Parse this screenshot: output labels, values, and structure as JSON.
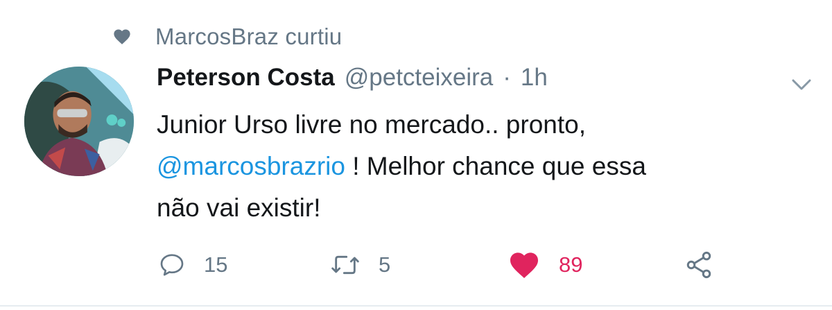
{
  "social_context": {
    "text": "MarcosBraz curtiu",
    "icon": "heart-icon"
  },
  "author": {
    "name": "Peterson Costa",
    "handle": "@petcteixeira",
    "separator": "·",
    "time": "1h"
  },
  "tweet": {
    "line1": "Junior Urso livre no mercado.. pronto,",
    "mention": "@marcosbrazrio",
    "line2_rest": " ! Melhor chance que essa",
    "line3": "não vai existir!"
  },
  "actions": {
    "reply": {
      "icon": "reply-icon",
      "count": "15"
    },
    "retweet": {
      "icon": "retweet-icon",
      "count": "5"
    },
    "like": {
      "icon": "heart-icon",
      "count": "89",
      "color": "#e0245e"
    },
    "share": {
      "icon": "share-icon"
    }
  },
  "colors": {
    "text": "#14171a",
    "secondary": "#657786",
    "link": "#1b95e0",
    "like": "#e0245e"
  }
}
